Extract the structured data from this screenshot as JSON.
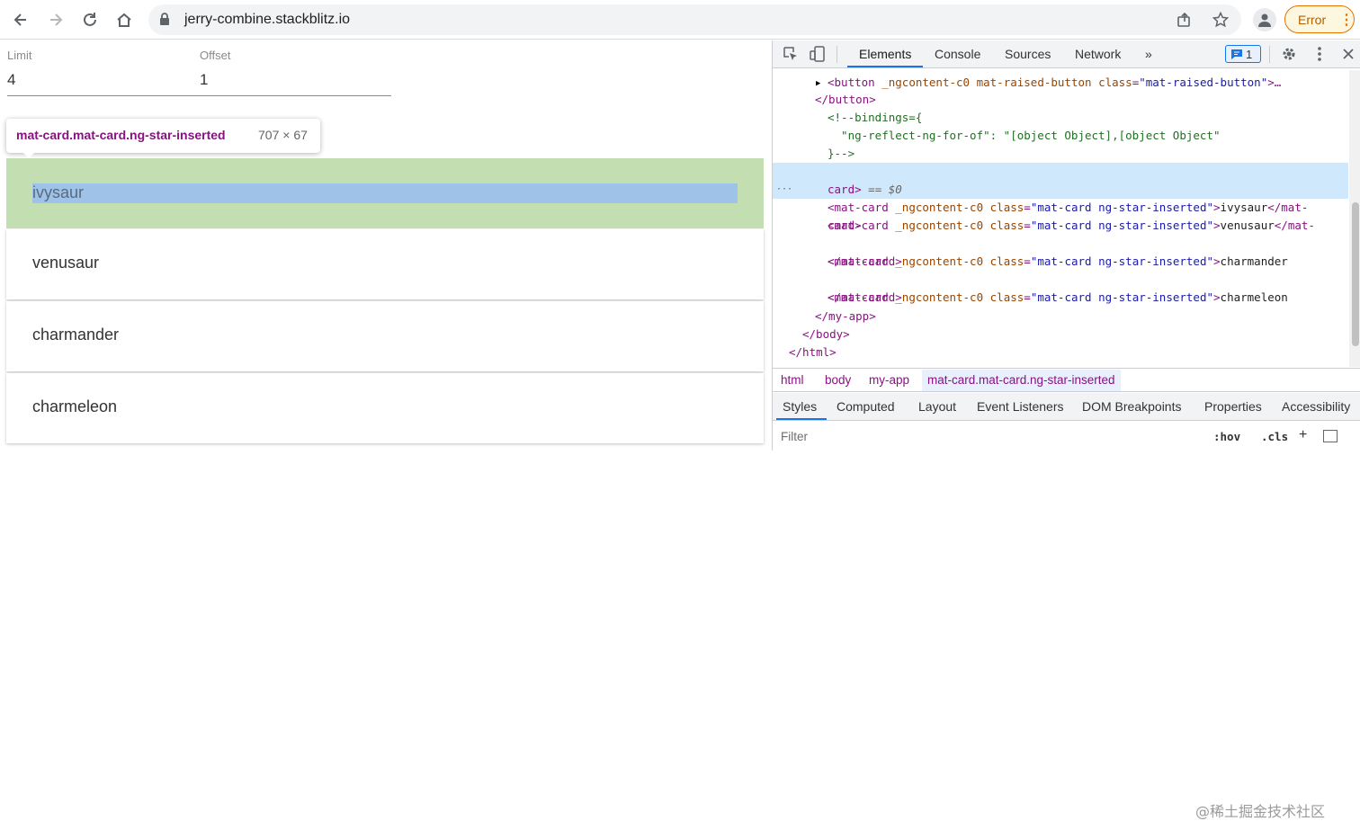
{
  "browser": {
    "url": "jerry-combine.stackblitz.io",
    "error_label": "Error",
    "colors": {
      "error_accent": "#e37400",
      "error_bg": "#fef7e0"
    }
  },
  "page": {
    "limit_label": "Limit",
    "limit_value": "4",
    "offset_label": "Offset",
    "offset_value": "1",
    "tooltip_selector": "mat-card.mat-card.ng-star-inserted",
    "tooltip_dimensions": "707 × 67",
    "cards": [
      "ivysaur",
      "venusaur",
      "charmander",
      "charmeleon"
    ],
    "colors": {
      "highlight_margin": "#c3dfb2",
      "highlight_content": "#9fc2e8"
    }
  },
  "devtools": {
    "tabs": [
      "Elements",
      "Console",
      "Sources",
      "Network"
    ],
    "more_tabs": "»",
    "issues_count": "1",
    "tree": {
      "button_line": {
        "open": "<button",
        "attr1": "_ngcontent-c0",
        "attr2": "mat-raised-button",
        "attr3": "class",
        "val3": "\"mat-raised-button\"",
        "close": ">…"
      },
      "button_close": "</button>",
      "comment1": "<!--bindings={",
      "comment2": "  \"ng-reflect-ng-for-of\": \"[object Object],[object Object\"",
      "comment3": "}-->",
      "card_open": "<mat-card",
      "card_attr": "_ngcontent-c0",
      "card_class_attr": "class",
      "card_class_val": "\"mat-card ng-star-inserted\"",
      "gt": ">",
      "names": [
        "ivysaur",
        "venusaur",
        "charmander",
        "charmeleon"
      ],
      "card_close_split_a": "</mat-",
      "card_close_split_b": "card>",
      "card_close_full": "</mat-card>",
      "sel_marker": "== $0",
      "myapp_close": "</my-app>",
      "body_close": "</body>",
      "html_close": "</html>",
      "ellipsis": "···",
      "expander": "▶"
    },
    "breadcrumbs": [
      "html",
      "body",
      "my-app",
      "mat-card.mat-card.ng-star-inserted"
    ],
    "styles_tabs": [
      "Styles",
      "Computed",
      "Layout",
      "Event Listeners",
      "DOM Breakpoints",
      "Properties",
      "Accessibility"
    ],
    "filter_placeholder": "Filter",
    "hov": ":hov",
    "cls": ".cls",
    "plus": "+",
    "watermark": "@稀土掘金技术社区"
  }
}
